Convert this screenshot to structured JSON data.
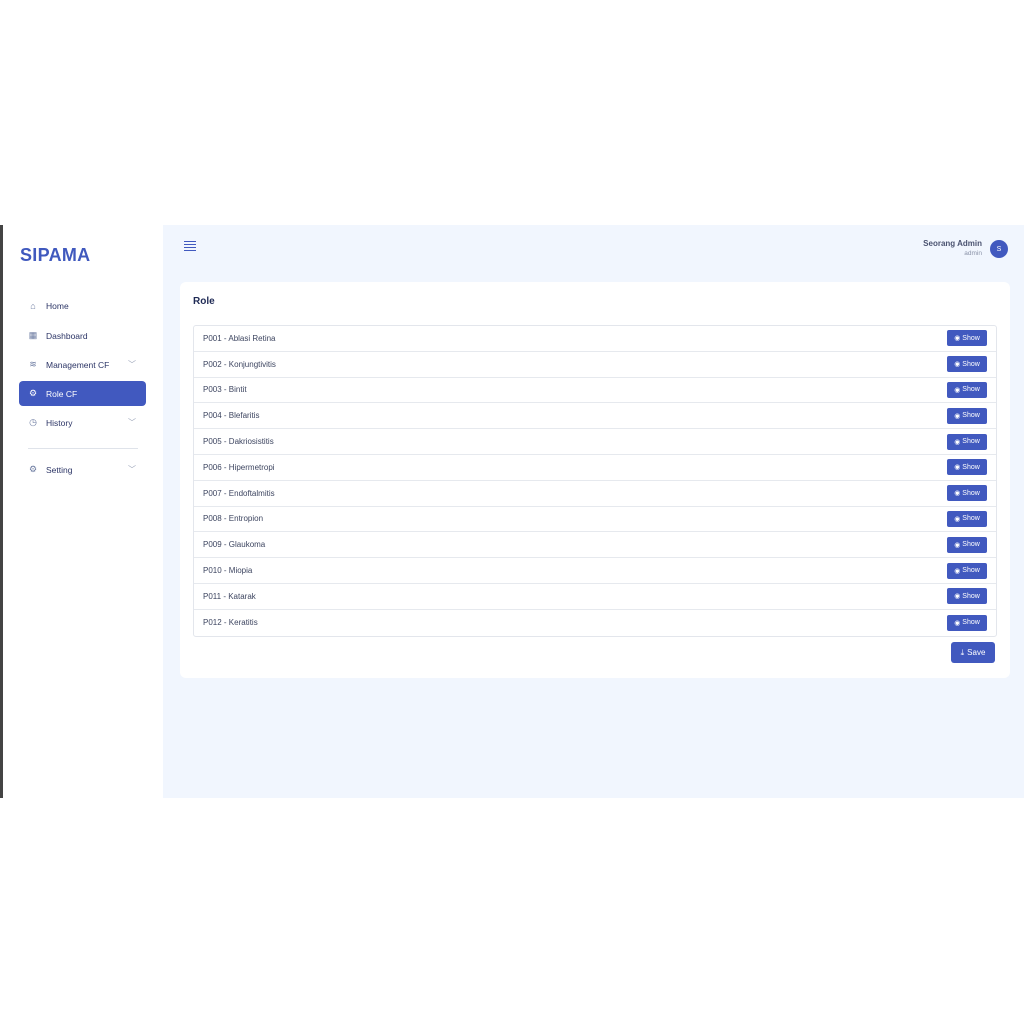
{
  "app": {
    "logo": "SIPAMA"
  },
  "sidebar": {
    "items": [
      {
        "label": "Home",
        "icon": "home-icon"
      },
      {
        "label": "Dashboard",
        "icon": "grid-icon"
      },
      {
        "label": "Management CF",
        "icon": "layers-icon"
      },
      {
        "label": "Role CF",
        "icon": "gear-icon"
      },
      {
        "label": "History",
        "icon": "clock-icon"
      },
      {
        "label": "Setting",
        "icon": "settings-icon"
      }
    ]
  },
  "header": {
    "user_name": "Seorang Admin",
    "user_role": "admin",
    "avatar_initial": "S"
  },
  "main": {
    "title": "Role",
    "show_label": "Show",
    "save_label": "Save",
    "rows": [
      "P001 - Ablasi Retina",
      "P002 - Konjungtivitis",
      "P003 - Bintit",
      "P004 - Blefaritis",
      "P005 - Dakriosistitis",
      "P006 - Hipermetropi",
      "P007 - Endoftalmitis",
      "P008 - Entropion",
      "P009 - Glaukoma",
      "P010 - Miopia",
      "P011 - Katarak",
      "P012 - Keratitis"
    ]
  },
  "colors": {
    "accent": "#4159bf",
    "background": "#f1f6fe"
  }
}
